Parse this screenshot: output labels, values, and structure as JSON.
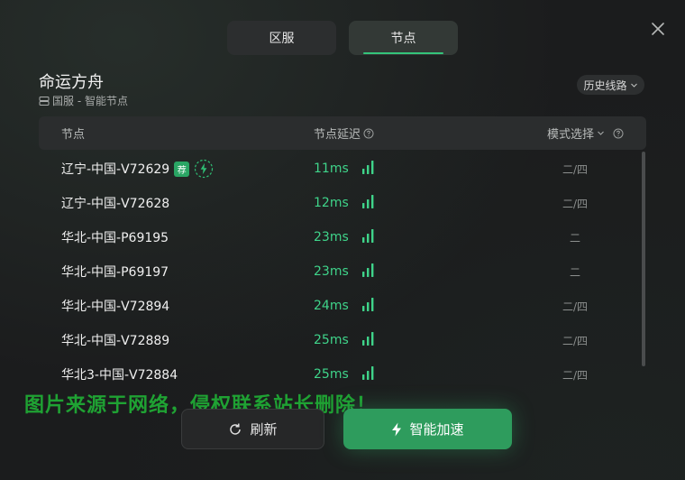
{
  "tabs": [
    {
      "label": "区服",
      "active": false
    },
    {
      "label": "节点",
      "active": true
    }
  ],
  "game": {
    "title": "命运方舟",
    "subtitle": "国服 - 智能节点"
  },
  "history_button": "历史线路",
  "table": {
    "headers": {
      "node": "节点",
      "latency": "节点延迟",
      "mode": "模式选择"
    },
    "rows": [
      {
        "name": "辽宁-中国-V72629",
        "recommended_badge": "荐",
        "latency": "11ms",
        "mode": "二/四"
      },
      {
        "name": "辽宁-中国-V72628",
        "latency": "12ms",
        "mode": "二/四"
      },
      {
        "name": "华北-中国-P69195",
        "latency": "23ms",
        "mode": "二"
      },
      {
        "name": "华北-中国-P69197",
        "latency": "23ms",
        "mode": "二"
      },
      {
        "name": "华北-中国-V72894",
        "latency": "24ms",
        "mode": "二/四"
      },
      {
        "name": "华北-中国-V72889",
        "latency": "25ms",
        "mode": "二/四"
      },
      {
        "name": "华北3-中国-V72884",
        "latency": "25ms",
        "mode": "二/四"
      }
    ]
  },
  "watermark": "图片来源于网络，侵权联系站长删除！",
  "buttons": {
    "refresh": "刷新",
    "accelerate": "智能加速"
  },
  "colors": {
    "accent": "#2e9c5d",
    "latency_green": "#3fd48a",
    "background": "#1b1c1d"
  }
}
